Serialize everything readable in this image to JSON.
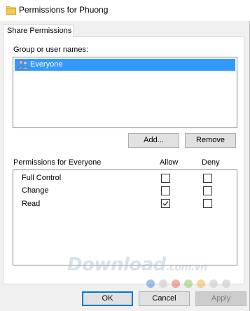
{
  "window": {
    "title": "Permissions for Phuong"
  },
  "tab": {
    "label": "Share Permissions"
  },
  "group": {
    "label": "Group or user names:",
    "items": [
      {
        "name": "Everyone",
        "selected": true
      }
    ]
  },
  "buttons": {
    "add": "Add...",
    "remove": "Remove",
    "ok": "OK",
    "cancel": "Cancel",
    "apply": "Apply"
  },
  "permissions": {
    "header": "Permissions for Everyone",
    "allow_label": "Allow",
    "deny_label": "Deny",
    "rows": [
      {
        "name": "Full Control",
        "allow": false,
        "deny": false
      },
      {
        "name": "Change",
        "allow": false,
        "deny": false
      },
      {
        "name": "Read",
        "allow": true,
        "deny": false
      }
    ]
  },
  "watermark": {
    "text": "Download",
    "suffix": ".com.vn",
    "dot_colors": [
      "#4a90d9",
      "#d0d0d0",
      "#e74c3c",
      "#7dc242",
      "#f5a623",
      "#d0d0d0",
      "#d0d0d0"
    ]
  },
  "colors": {
    "selection": "#3399ff",
    "primary_border": "#0078d7",
    "folder": "#e8b840"
  }
}
